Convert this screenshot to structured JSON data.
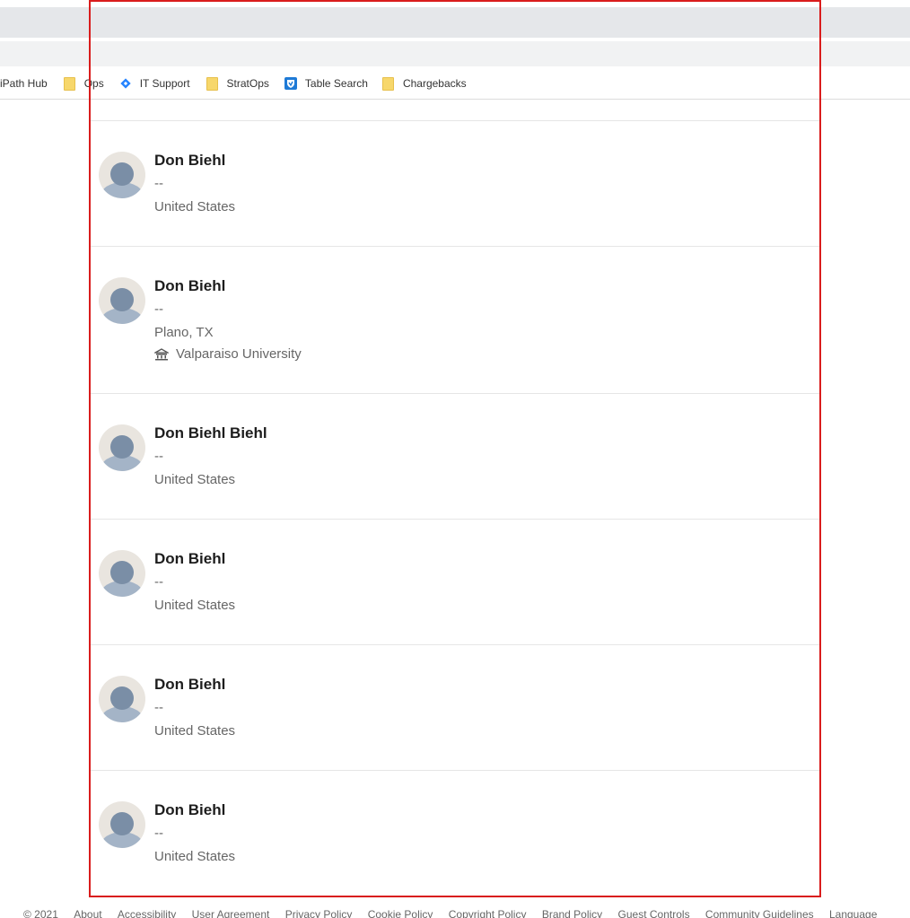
{
  "bookmarks": [
    {
      "label": "iPath Hub",
      "icon": "none"
    },
    {
      "label": "Ops",
      "icon": "folder-icon"
    },
    {
      "label": "IT Support",
      "icon": "jira-icon"
    },
    {
      "label": "StratOps",
      "icon": "folder-icon"
    },
    {
      "label": "Table Search",
      "icon": "shield-icon"
    },
    {
      "label": "Chargebacks",
      "icon": "folder-icon"
    }
  ],
  "results": [
    {
      "name": "Don Biehl",
      "headline": "--",
      "location": "United States"
    },
    {
      "name": "Don Biehl",
      "headline": "--",
      "location": "Plano, TX",
      "school": "Valparaiso University"
    },
    {
      "name": "Don Biehl Biehl",
      "headline": "--",
      "location": "United States"
    },
    {
      "name": "Don Biehl",
      "headline": "--",
      "location": "United States"
    },
    {
      "name": "Don Biehl",
      "headline": "--",
      "location": "United States"
    },
    {
      "name": "Don Biehl",
      "headline": "--",
      "location": "United States"
    }
  ],
  "footer": {
    "copyright": "© 2021",
    "links": [
      "About",
      "Accessibility",
      "User Agreement",
      "Privacy Policy",
      "Cookie Policy",
      "Copyright Policy",
      "Brand Policy",
      "Guest Controls",
      "Community Guidelines",
      "Language"
    ]
  },
  "colors": {
    "highlight_border": "#d91c1c",
    "avatar_bg": "#e9e5df",
    "avatar_person": "#7a8ea6"
  }
}
